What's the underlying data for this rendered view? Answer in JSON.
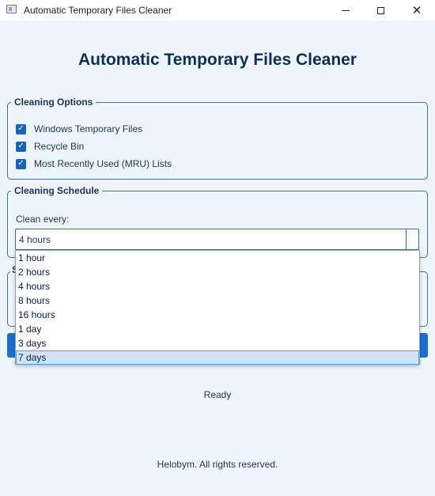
{
  "window": {
    "title": "Automatic Temporary Files Cleaner"
  },
  "heading": "Automatic Temporary Files Cleaner",
  "cleaning_options": {
    "legend": "Cleaning Options",
    "items": [
      {
        "label": "Windows Temporary Files",
        "checked": true
      },
      {
        "label": "Recycle Bin",
        "checked": true
      },
      {
        "label": "Most Recently Used (MRU) Lists",
        "checked": true
      }
    ]
  },
  "schedule": {
    "legend": "Cleaning Schedule",
    "clean_every_label": "Clean every:",
    "selected_value": "4 hours",
    "options": [
      "1 hour",
      "2 hours",
      "4 hours",
      "8 hours",
      "16 hours",
      "1 day",
      "3 days",
      "7 days"
    ],
    "highlighted_option": "7 days"
  },
  "third_group": {
    "legend_visible": "S"
  },
  "status": "Ready",
  "footer": "Helobym. All rights reserved.",
  "colors": {
    "accent": "#1a6fd0",
    "heading": "#0e2e57",
    "background": "#eff5fc"
  }
}
